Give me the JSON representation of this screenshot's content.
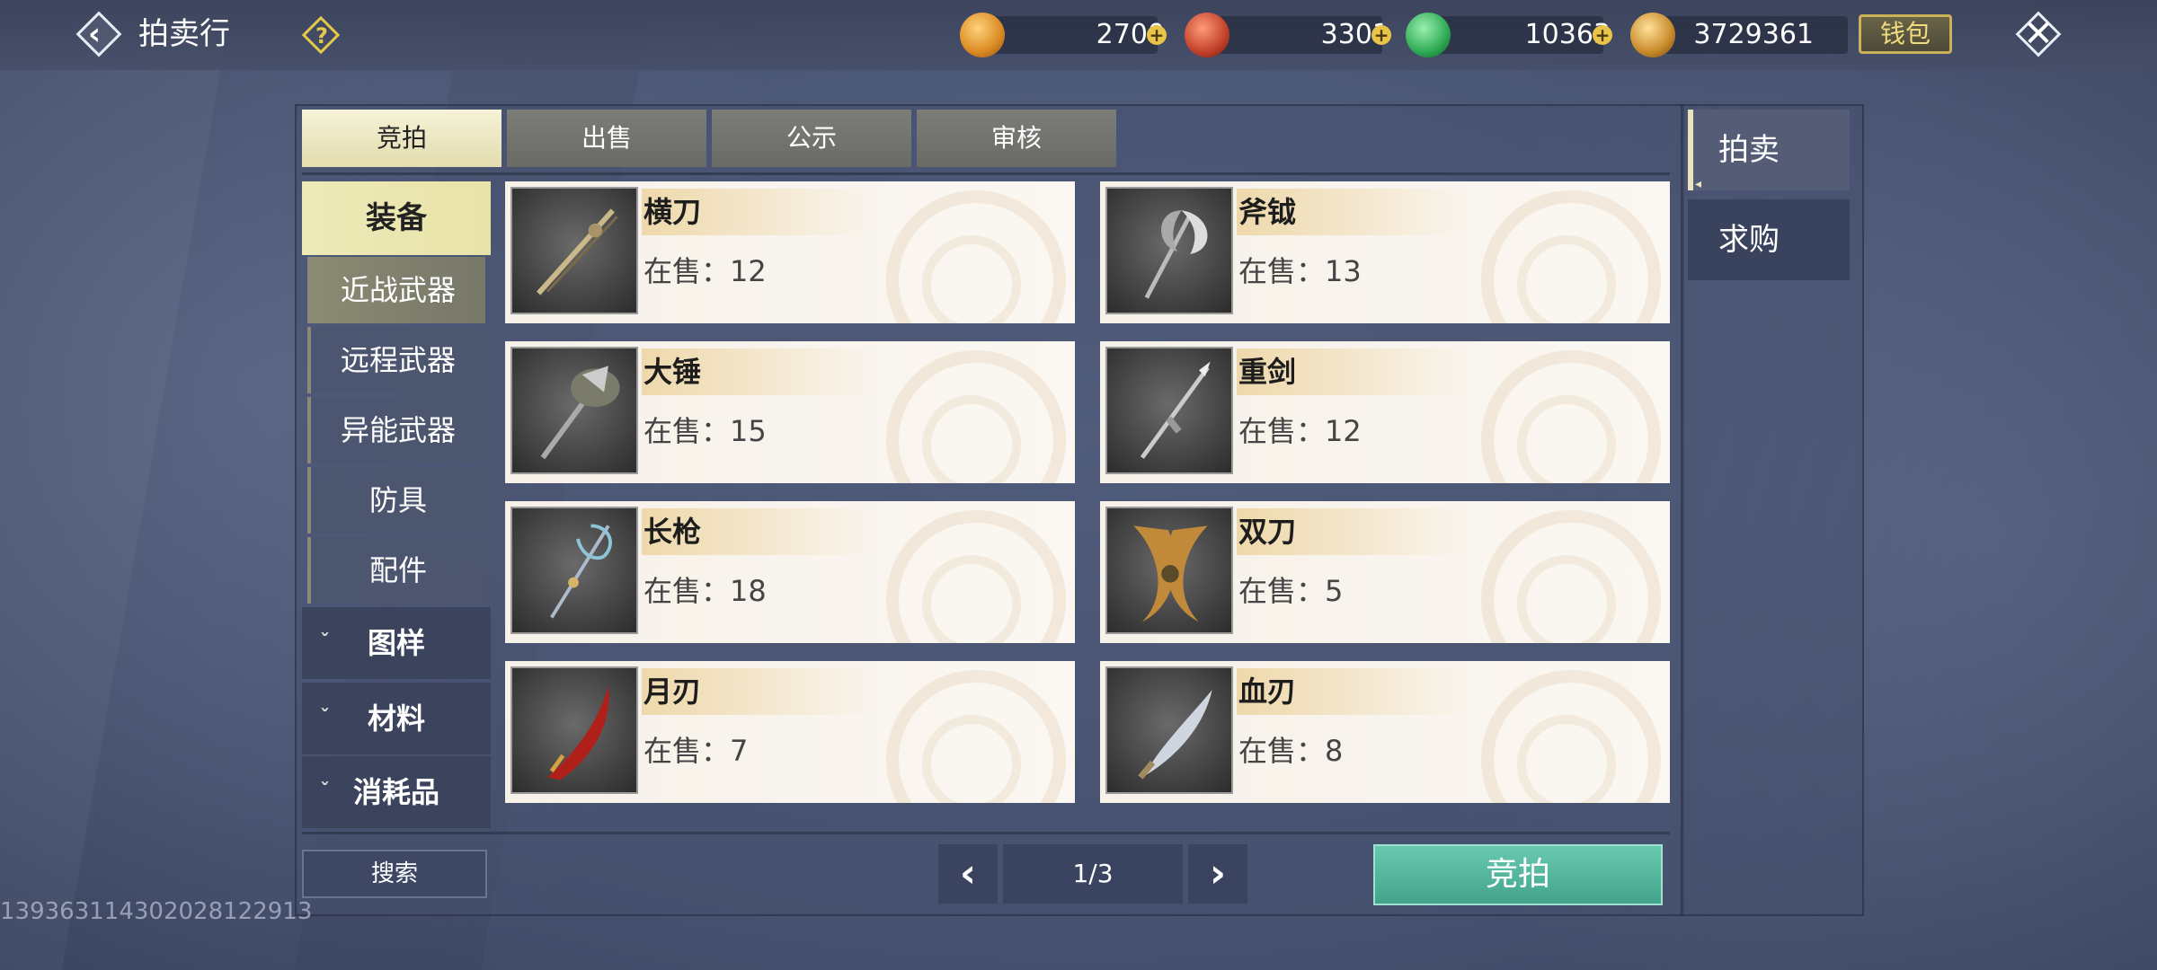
{
  "header": {
    "title": "拍卖行",
    "help": "?",
    "currencies": [
      {
        "icon": "gold-coin-icon",
        "value": "2700",
        "color": "#d98a22"
      },
      {
        "icon": "red-swirl-icon",
        "value": "3301",
        "color": "#c2412a"
      },
      {
        "icon": "jade-icon",
        "value": "10363",
        "color": "#2faa55"
      },
      {
        "icon": "gold-leaf-icon",
        "value": "3729361",
        "color": "#c88a2a"
      }
    ],
    "plus": "+",
    "wallet_label": "钱包"
  },
  "tabs": [
    {
      "label": "竞拍",
      "active": true
    },
    {
      "label": "出售",
      "active": false
    },
    {
      "label": "公示",
      "active": false
    },
    {
      "label": "审核",
      "active": false
    }
  ],
  "categories": {
    "main": "装备",
    "subs": [
      {
        "label": "近战武器",
        "active": true
      },
      {
        "label": "远程武器",
        "active": false
      },
      {
        "label": "异能武器",
        "active": false
      },
      {
        "label": "防具",
        "active": false
      },
      {
        "label": "配件",
        "active": false
      }
    ],
    "collapsed": [
      "图样",
      "材料",
      "消耗品"
    ]
  },
  "items": [
    {
      "name": "横刀",
      "stock_label": "在售：",
      "stock": "12"
    },
    {
      "name": "斧钺",
      "stock_label": "在售：",
      "stock": "13"
    },
    {
      "name": "大锤",
      "stock_label": "在售：",
      "stock": "15"
    },
    {
      "name": "重剑",
      "stock_label": "在售：",
      "stock": "12"
    },
    {
      "name": "长枪",
      "stock_label": "在售：",
      "stock": "18"
    },
    {
      "name": "双刀",
      "stock_label": "在售：",
      "stock": "5"
    },
    {
      "name": "月刃",
      "stock_label": "在售：",
      "stock": "7"
    },
    {
      "name": "血刃",
      "stock_label": "在售：",
      "stock": "8"
    }
  ],
  "footer": {
    "search_label": "搜索",
    "page": "1/3",
    "bid_label": "竞拍"
  },
  "right_tabs": [
    {
      "label": "拍卖",
      "active": true
    },
    {
      "label": "求购",
      "active": false
    }
  ],
  "uid": "1393631143020281229​13"
}
